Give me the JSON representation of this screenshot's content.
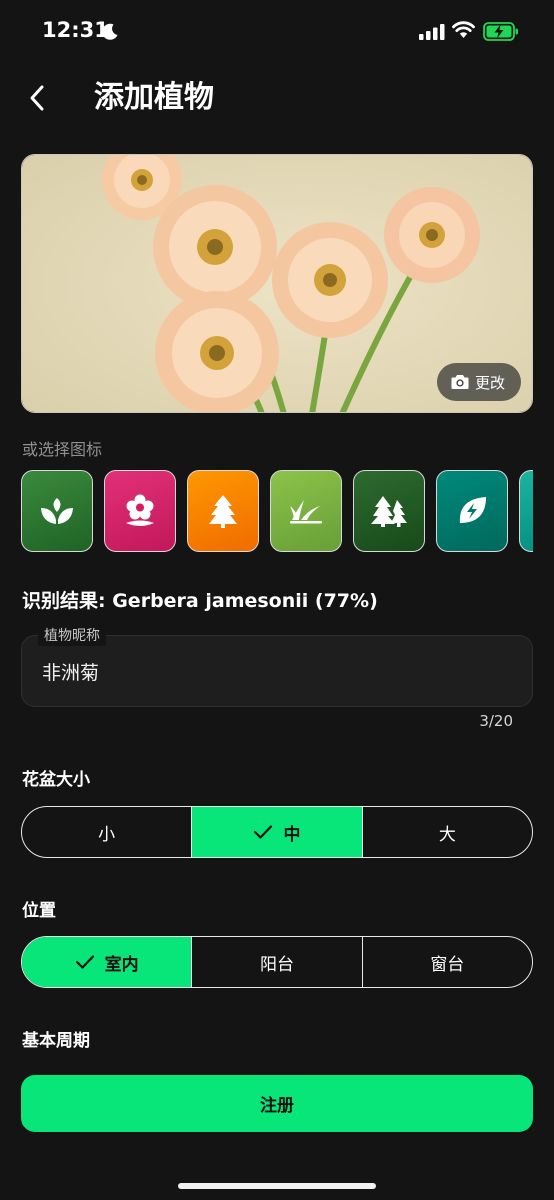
{
  "status_bar": {
    "time": "12:31"
  },
  "header": {
    "title": "添加植物"
  },
  "photo": {
    "change_label": "更改"
  },
  "icon_section": {
    "hint": "或选择图标",
    "icons": [
      {
        "name": "sprout-icon",
        "color": "#2e7d32"
      },
      {
        "name": "flower-icon",
        "color": "#d81b60"
      },
      {
        "name": "pine-tree-icon",
        "color": "#f57c00"
      },
      {
        "name": "grass-icon",
        "color": "#7cb342"
      },
      {
        "name": "forest-icon",
        "color": "#1b5e20"
      },
      {
        "name": "eco-leaf-icon",
        "color": "#00796b"
      },
      {
        "name": "partial-icon",
        "color": "#009e8a"
      }
    ]
  },
  "identification": {
    "result": "识别结果: Gerbera jamesonii (77%)"
  },
  "nickname": {
    "label": "植物昵称",
    "value": "非洲菊",
    "counter": "3/20"
  },
  "pot_size": {
    "label": "花盆大小",
    "options": [
      "小",
      "中",
      "大"
    ],
    "selected": "中"
  },
  "location": {
    "label": "位置",
    "options": [
      "室内",
      "阳台",
      "窗台"
    ],
    "selected": "室内"
  },
  "cycle": {
    "label": "基本周期"
  },
  "submit": {
    "label": "注册"
  },
  "colors": {
    "accent": "#08e67a",
    "background": "#141414"
  }
}
